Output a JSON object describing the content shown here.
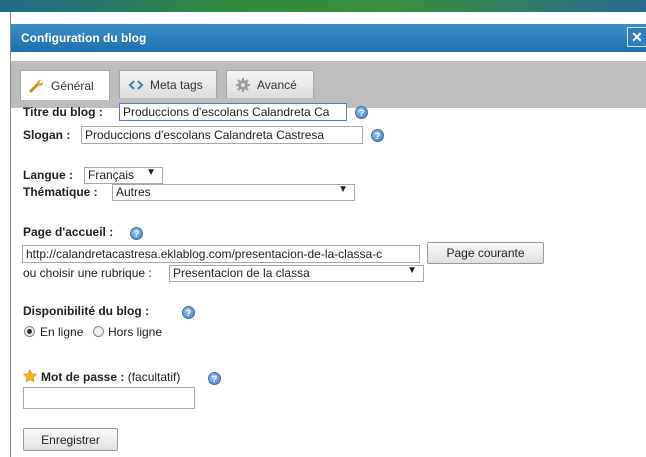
{
  "dialog": {
    "title": "Configuration du blog",
    "close_label": "✕"
  },
  "tabs": [
    {
      "label": "Général",
      "icon": "wrench-icon",
      "active": true
    },
    {
      "label": "Meta tags",
      "icon": "code-brackets-icon",
      "active": false
    },
    {
      "label": "Avancé",
      "icon": "gear-icon",
      "active": false
    }
  ],
  "form": {
    "blog_title_label": "Titre du blog :",
    "blog_title_value": "Produccions d'escolans Calandreta Ca",
    "slogan_label": "Slogan :",
    "slogan_value": "Produccions d'escolans Calandreta Castresa",
    "language_label": "Langue :",
    "language_value": "Français",
    "theme_label": "Thématique :",
    "theme_value": "Autres",
    "homepage_label": "Page d'accueil :",
    "homepage_url": "http://calandretacastresa.eklablog.com/presentacion-de-la-classa-c",
    "current_page_button": "Page courante",
    "rubric_label": "ou choisir une rubrique :",
    "rubric_value": "Presentacion de la classa",
    "availability_label": "Disponibilité du blog :",
    "online_label": "En ligne",
    "offline_label": "Hors ligne",
    "online_selected": true,
    "password_label": "Mot de passe :",
    "password_optional": "(facultatif)",
    "password_value": "",
    "save_button": "Enregistrer"
  },
  "colors": {
    "titlebar": "#1f6fae",
    "tabbar": "#bdbdbd",
    "help_icon": "#3d78c4"
  }
}
